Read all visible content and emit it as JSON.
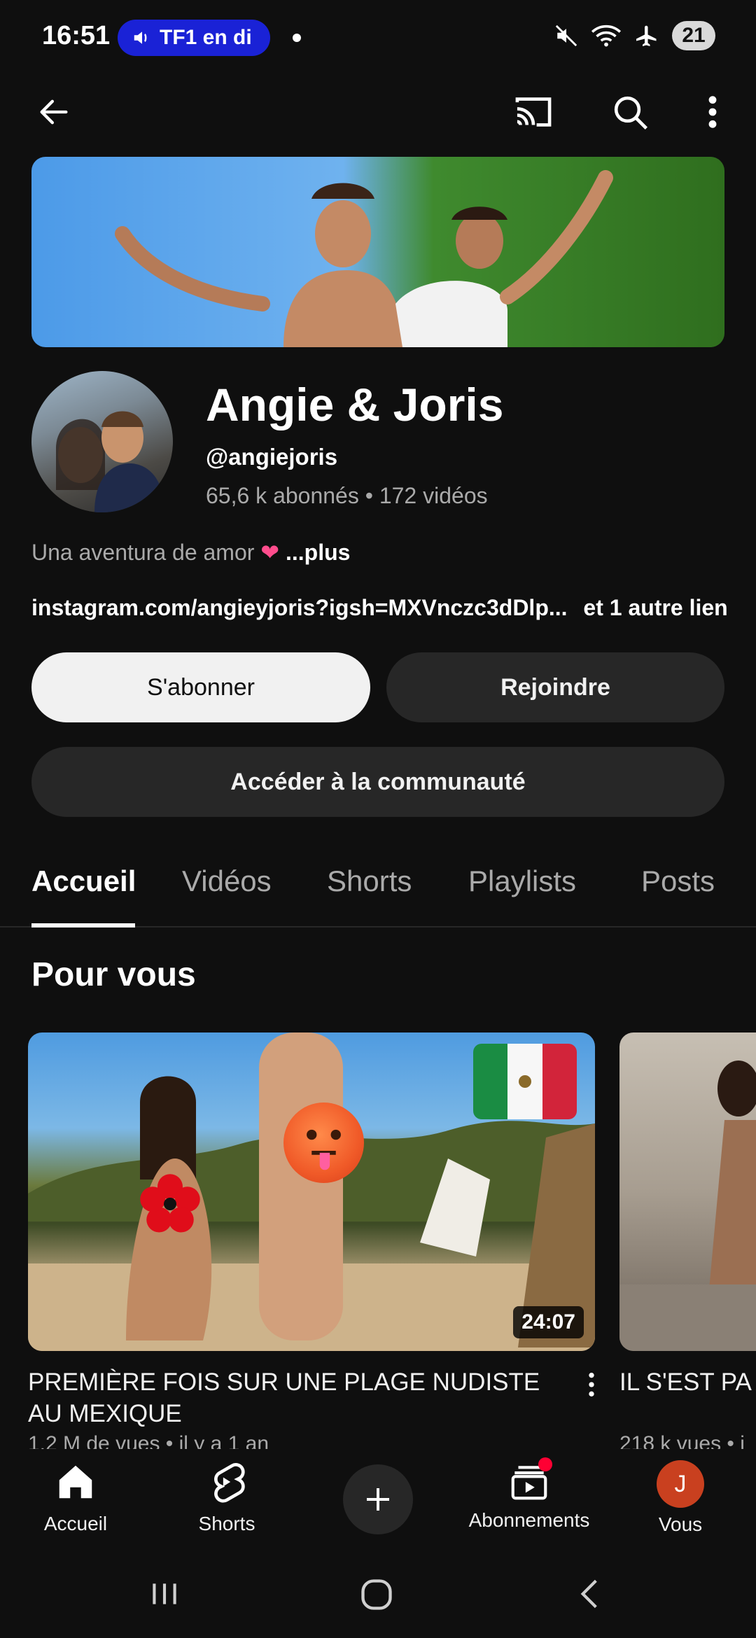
{
  "status_bar": {
    "time": "16:51",
    "media_pill": "TF1 en di",
    "battery": "21"
  },
  "channel": {
    "name": "Angie & Joris",
    "handle": "@angiejoris",
    "stats": "65,6 k abonnés • 172 vidéos",
    "description": "Una aventura de amor",
    "description_more": "...plus",
    "link": "instagram.com/angieyjoris?igsh=MXVnczc3dDlp...",
    "other_links": "et 1 autre lien"
  },
  "buttons": {
    "subscribe": "S'abonner",
    "join": "Rejoindre",
    "community": "Accéder à la communauté"
  },
  "tabs": [
    {
      "label": "Accueil",
      "active": true
    },
    {
      "label": "Vidéos",
      "active": false
    },
    {
      "label": "Shorts",
      "active": false
    },
    {
      "label": "Playlists",
      "active": false
    },
    {
      "label": "Posts",
      "active": false
    }
  ],
  "section": {
    "title": "Pour vous"
  },
  "videos": [
    {
      "title": "PREMIÈRE FOIS SUR UNE PLAGE NUDISTE AU MEXIQUE",
      "meta": "1,2 M de vues • il y a 1 an",
      "duration": "24:07"
    },
    {
      "title": "IL S'EST PA AUX BAÑOS",
      "meta": "218 k vues • i"
    }
  ],
  "bottom_nav": {
    "home": "Accueil",
    "shorts": "Shorts",
    "subscriptions": "Abonnements",
    "you": "Vous",
    "you_initial": "J"
  },
  "colors": {
    "background": "#0f0f0f",
    "surface": "#272727",
    "text_secondary": "#aaaaaa",
    "accent_red": "#ff0033",
    "pill_blue": "#1a22d6"
  }
}
